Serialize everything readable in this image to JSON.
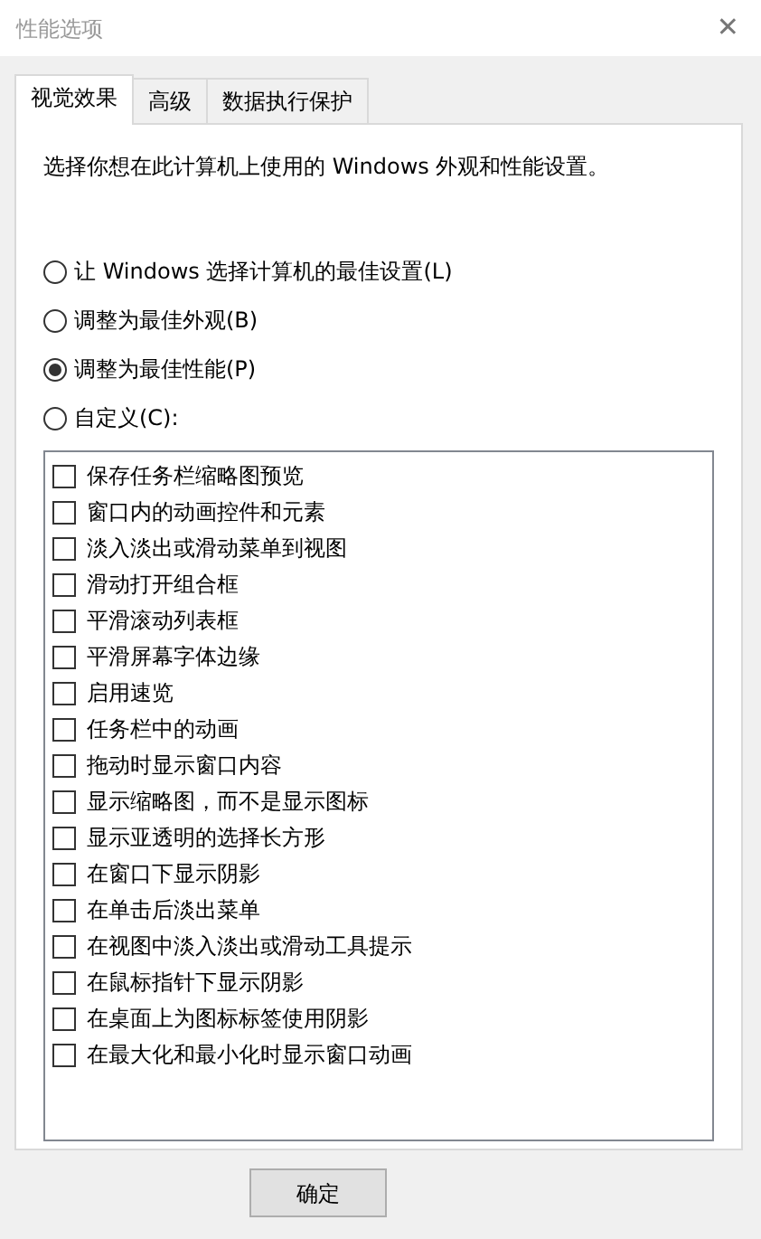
{
  "window": {
    "title": "性能选项",
    "close": "✕"
  },
  "tabs": [
    {
      "label": "视觉效果",
      "selected": true
    },
    {
      "label": "高级",
      "selected": false
    },
    {
      "label": "数据执行保护",
      "selected": false
    }
  ],
  "description": "选择你想在此计算机上使用的 Windows 外观和性能设置。",
  "options": [
    {
      "label": "让 Windows 选择计算机的最佳设置(L)",
      "selected": false
    },
    {
      "label": "调整为最佳外观(B)",
      "selected": false
    },
    {
      "label": "调整为最佳性能(P)",
      "selected": true
    },
    {
      "label": "自定义(C):",
      "selected": false
    }
  ],
  "effects": [
    {
      "label": "保存任务栏缩略图预览",
      "checked": false
    },
    {
      "label": "窗口内的动画控件和元素",
      "checked": false
    },
    {
      "label": "淡入淡出或滑动菜单到视图",
      "checked": false
    },
    {
      "label": "滑动打开组合框",
      "checked": false
    },
    {
      "label": "平滑滚动列表框",
      "checked": false
    },
    {
      "label": "平滑屏幕字体边缘",
      "checked": false
    },
    {
      "label": "启用速览",
      "checked": false
    },
    {
      "label": "任务栏中的动画",
      "checked": false
    },
    {
      "label": "拖动时显示窗口内容",
      "checked": false
    },
    {
      "label": "显示缩略图，而不是显示图标",
      "checked": false
    },
    {
      "label": "显示亚透明的选择长方形",
      "checked": false
    },
    {
      "label": "在窗口下显示阴影",
      "checked": false
    },
    {
      "label": "在单击后淡出菜单",
      "checked": false
    },
    {
      "label": "在视图中淡入淡出或滑动工具提示",
      "checked": false
    },
    {
      "label": "在鼠标指针下显示阴影",
      "checked": false
    },
    {
      "label": "在桌面上为图标标签使用阴影",
      "checked": false
    },
    {
      "label": "在最大化和最小化时显示窗口动画",
      "checked": false
    }
  ],
  "buttons": [
    "确定"
  ]
}
